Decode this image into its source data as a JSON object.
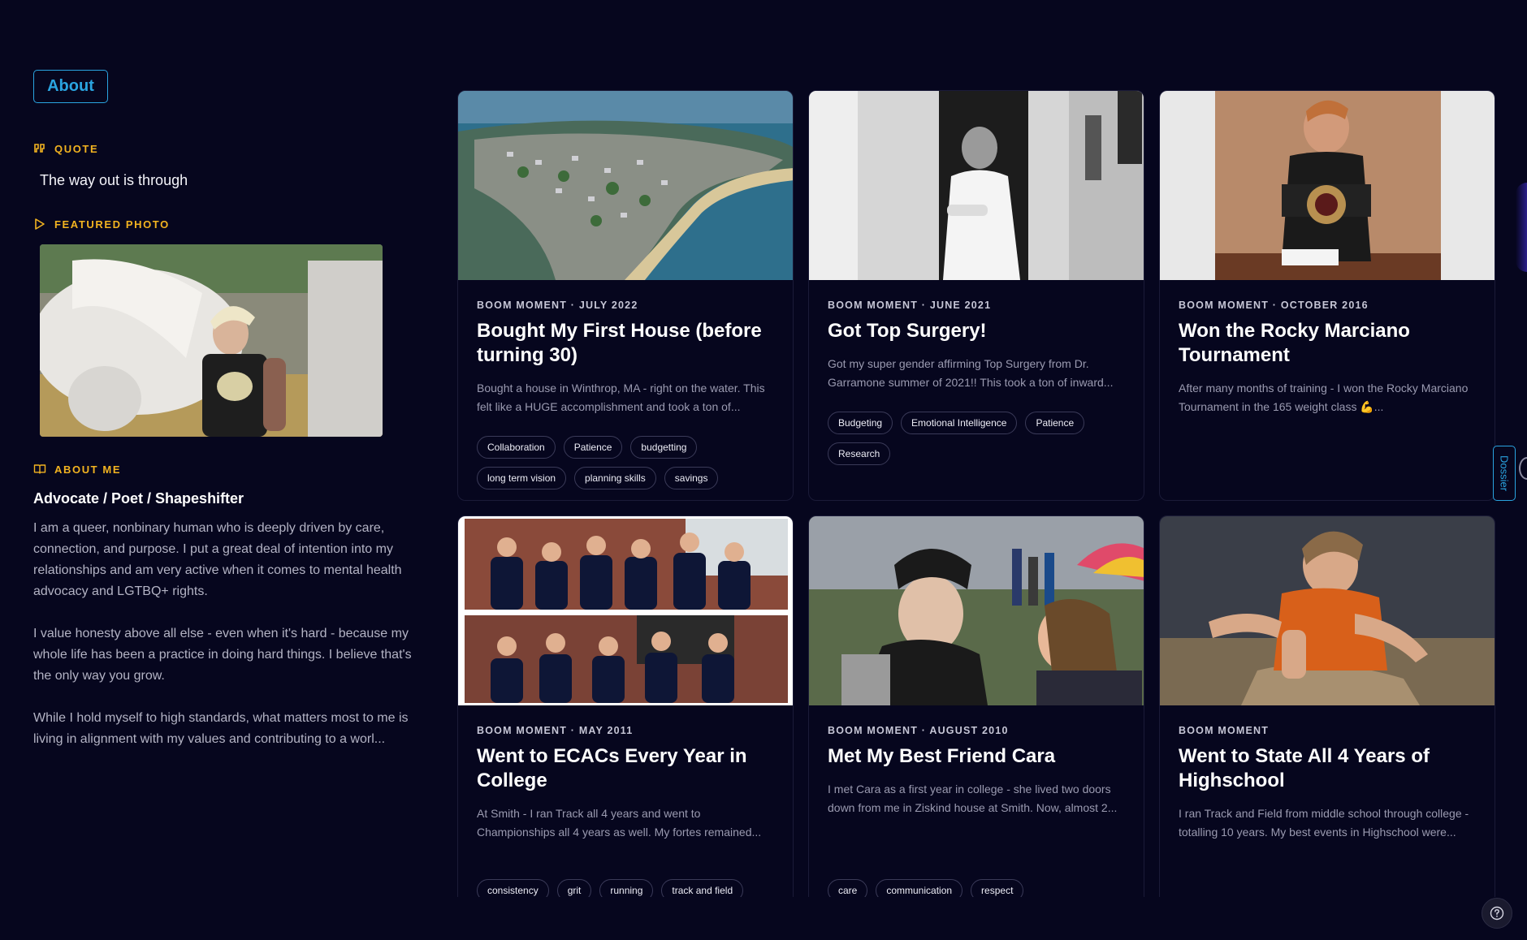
{
  "about_tab": "About",
  "sidebar": {
    "quote_label": "QUOTE",
    "quote_text": "The way out is through",
    "featured_label": "FEATURED PHOTO",
    "about_label": "ABOUT ME",
    "about_heading": "Advocate / Poet / Shapeshifter",
    "paragraphs": [
      "I am a queer, nonbinary human who is deeply driven by care, connection, and purpose. I put a great deal of intention into my relationships and am very active when it comes to mental health advocacy and LGTBQ+ rights.",
      "I value honesty above all else - even when it's hard - because my whole life has been a practice in doing hard things. I believe that's the only way you grow.",
      "While I hold myself to high standards, what matters most to me is living in alignment with my values and contributing to a worl..."
    ]
  },
  "cards": [
    {
      "meta": "BOOM MOMENT · JULY 2022",
      "title": "Bought My First House (before turning 30)",
      "desc": "Bought a house in Winthrop, MA - right on the water. This felt like a HUGE accomplishment and took a ton of...",
      "tags": [
        "Collaboration",
        "Patience",
        "budgetting",
        "long term vision",
        "planning skills",
        "savings"
      ]
    },
    {
      "meta": "BOOM MOMENT · JUNE 2021",
      "title": "Got Top Surgery!",
      "desc": "Got my super gender affirming Top Surgery from Dr. Garramone summer of 2021!! This took a ton of inward...",
      "tags": [
        "Budgeting",
        "Emotional Intelligence",
        "Patience",
        "Research"
      ]
    },
    {
      "meta": "BOOM MOMENT · OCTOBER 2016",
      "title": "Won the Rocky Marciano Tournament",
      "desc": "After many months of training - I won the Rocky Marciano Tournament in the 165 weight class 💪...",
      "tags": []
    },
    {
      "meta": "BOOM MOMENT · MAY 2011",
      "title": "Went to ECACs Every Year in College",
      "desc": "At Smith - I ran Track all 4 years and went to Championships all 4 years as well. My fortes remained...",
      "tags": [
        "consistency",
        "grit",
        "running",
        "track and field"
      ]
    },
    {
      "meta": "BOOM MOMENT · AUGUST 2010",
      "title": "Met My Best Friend Cara",
      "desc": "I met Cara as a first year in college - she lived two doors down from me in Ziskind house at Smith.  Now, almost 2...",
      "tags": [
        "care",
        "communication",
        "respect"
      ]
    },
    {
      "meta": "BOOM MOMENT",
      "title": "Went to State All 4 Years of Highschool",
      "desc": "I ran Track and Field from middle school through college - totalling 10 years.  My best events in Highschool were...",
      "tags": []
    }
  ],
  "dossier_tab": "Dossier",
  "colors": {
    "background": "#06061e",
    "accent_blue": "#2aa4e0",
    "accent_gold": "#f2b320"
  },
  "icons": [
    "quote-icon",
    "play-icon",
    "book-icon",
    "help-icon"
  ]
}
